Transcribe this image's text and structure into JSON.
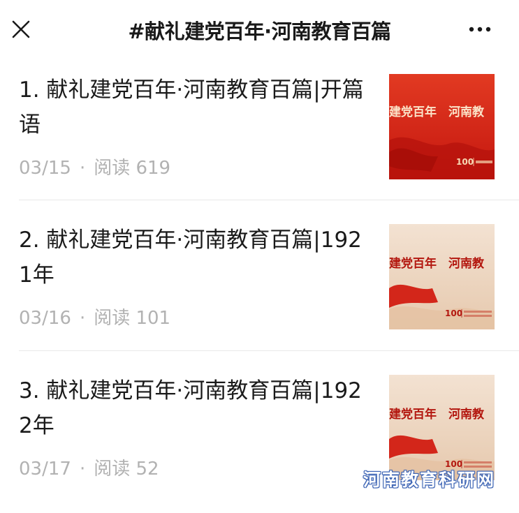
{
  "header": {
    "title": "#献礼建党百年·河南教育百篇",
    "close_icon": "close-icon",
    "more_icon": "more-icon"
  },
  "articles": [
    {
      "title": "1. 献礼建党百年·河南教育百篇|开篇语",
      "date": "03/15",
      "separator": "·",
      "reads": "阅读 619",
      "thumb_text": "建党百年　河南教",
      "thumb_logo": "100",
      "thumb_style": "red"
    },
    {
      "title": "2. 献礼建党百年·河南教育百篇|1921年",
      "date": "03/16",
      "separator": "·",
      "reads": "阅读 101",
      "thumb_text": "建党百年　河南教",
      "thumb_logo": "100",
      "thumb_style": "beige"
    },
    {
      "title": "3. 献礼建党百年·河南教育百篇|1922年",
      "date": "03/17",
      "separator": "·",
      "reads": "阅读 52",
      "thumb_text": "建党百年　河南教",
      "thumb_logo": "100",
      "thumb_style": "beige"
    }
  ],
  "watermark": "河南教育科研网",
  "colors": {
    "meta_gray": "#b2b2b2",
    "red_banner": "#d42a1e",
    "beige_banner": "#efd9c6",
    "watermark_blue": "#3b63b4"
  }
}
